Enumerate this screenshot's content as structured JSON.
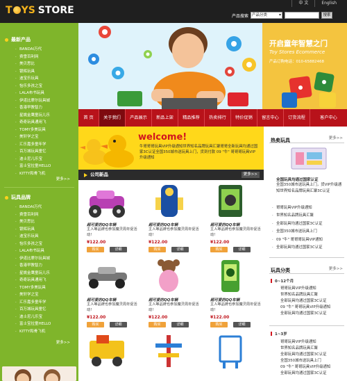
{
  "header": {
    "logo_part1": "T",
    "logo_part2": "YS",
    "logo_part3": "STORE",
    "lang": [
      "中 文",
      "English"
    ],
    "search_label": "产品搜索",
    "search_select": "产品分类",
    "search_button": "搜索"
  },
  "sidebar": {
    "new_title": "最新产品",
    "new_items": [
      "BANDAI万代",
      "费雪百利网",
      "美贝思比",
      "银辉玩具",
      "迪宝乐玩具",
      "怡乐多孩之宝",
      "LALA布书玩具",
      "伊诺比摩尔玩具城",
      "香港早教智力",
      "星姚金鹰童玩儿乐",
      "奇奇玩具通用飞",
      "TOMY多美玩具",
      "美轩学之宝",
      "汇乐嘉多童年学",
      "百万城玩具童忆",
      "迪士尼儿乐宝",
      "富士宝拉童HELLO",
      "KITTY和骨飞机"
    ],
    "new_more": "更多>>",
    "brand_title": "玩具品牌",
    "brand_items": [
      "BANDAI万代",
      "费雪百利网",
      "美贝思比",
      "银辉玩具",
      "迪宝乐玩具",
      "怡乐多孩之宝",
      "LALA布书玩具",
      "伊诺比摩尔玩具城",
      "香港早教智力",
      "星姚金鹰童玩儿乐",
      "奇奇玩具通用飞",
      "TOMY多美玩具",
      "美轩学之宝",
      "汇乐嘉多童年学",
      "百万城玩具童忆",
      "迪士尼儿乐宝",
      "富士宝拉童HELLO",
      "KITTY和骨飞机"
    ],
    "brand_more": "更多>>"
  },
  "banner": {
    "title": "开启童年智慧之门",
    "subtitle": "Toy Stores Ecommerce",
    "phone": "产品订购电话：010-65882468"
  },
  "nav": [
    "首 页",
    "关于我们",
    "产品展示",
    "新品上架",
    "精品推荐",
    "热卖排行",
    "特价促销",
    "留言中心",
    "订货流程",
    "客户中心"
  ],
  "welcome": {
    "title": "welcome!",
    "text": "牛哥哥哥玩具VIP升级通知世界知名品牌玩具汇聚哥哥全新玩具均通过国家3C认证全国350城市送玩具上门，货到付款 09 \"牛\" 哥哥哥玩具VIP升级通知"
  },
  "products": {
    "header": "公司新品",
    "more": "更多>>",
    "items": [
      {
        "name": "超可爱的QQ车辆",
        "desc": "主人等品牌也参加魔灵周年促活动!",
        "price": "¥122.00",
        "buy": "购买",
        "detail": "详细"
      },
      {
        "name": "超可爱的QQ车辆",
        "desc": "主人等品牌也参加魔灵周年促活动!",
        "price": "¥122.00",
        "buy": "购买",
        "detail": "详细"
      },
      {
        "name": "超可爱的QQ车辆",
        "desc": "主人等品牌也参加魔灵周年促活动!",
        "price": "¥122.00",
        "buy": "购买",
        "detail": "详细"
      },
      {
        "name": "超可爱的QQ车辆",
        "desc": "主人等品牌也参加魔灵周年促活动!",
        "price": "¥122.00",
        "buy": "购买",
        "detail": "详细"
      },
      {
        "name": "超可爱的QQ车辆",
        "desc": "主人等品牌也参加魔灵周年促活动!",
        "price": "¥122.00",
        "buy": "购买",
        "detail": "详细"
      },
      {
        "name": "超可爱的QQ车辆",
        "desc": "主人等品牌也参加魔灵周年促活动!",
        "price": "¥122.00",
        "buy": "购买",
        "detail": "详细"
      }
    ]
  },
  "hot": {
    "title": "热卖玩具",
    "more": "更多>>",
    "item_title": "全国玩具均通过国家认证",
    "item_desc": "全国350城市送玩具上门，货VIP升级通知世界知名品牌玩具汇聚3C认证",
    "list": [
      "哥哥玩具VIP升级通知",
      "世界知名品牌玩具汇聚",
      "全部玩具均通过国家3C认证",
      "全国350城市送玩具上门",
      "09 \"牛\" 哥哥哥玩具VIP通知",
      "全部玩具均通过国家3C认证"
    ]
  },
  "category": {
    "title": "玩具分类",
    "more": "更多>>",
    "sub1": "0~12个月",
    "list1": [
      "哥哥玩具VIP升级通知",
      "世界知名品牌玩具汇聚",
      "全部玩具均通过国家3C认证",
      "09 \"牛\" 哥哥玩具VIP升级通知",
      "全部玩具均通过国家3C认证"
    ],
    "sub2": "1~3岁",
    "list2": [
      "哥哥玩具VIP升级通知",
      "世界知名品牌玩具汇聚",
      "全部玩具均通过国家3C认证",
      "全国350城市送玩具上门",
      "09 \"牛\" 哥哥玩具VIP升级通知",
      "全部玩具均通过国家3C认证"
    ]
  },
  "colors": {
    "brand_red": "#b8121a",
    "sidebar_green": "#7fb52b",
    "header_dark": "#1f1f1f",
    "accent_yellow": "#ffd81a"
  }
}
